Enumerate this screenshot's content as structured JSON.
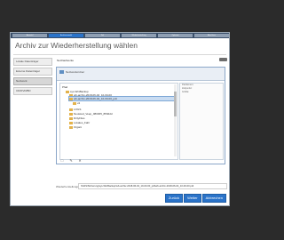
{
  "steps": [
    "Auswahl",
    "Archivauswahl",
    "Ziel",
    "Wiederherstellung",
    "Optionen",
    "Abschluss"
  ],
  "window": {
    "title": "Archiv zur Wiederherstellung wählen"
  },
  "sidebar": {
    "items": [
      {
        "label": "Lokale Datenträger"
      },
      {
        "label": "Externe Datenträger"
      },
      {
        "label": "Netzwerk"
      },
      {
        "label": "CD/DVD/BD"
      }
    ]
  },
  "filter": {
    "label": "Netzlaufwerke"
  },
  "browser": {
    "header": "Netzwerkordner",
    "path_root": "Pfad",
    "tree": [
      {
        "label": "sys-WinBackup",
        "indent": 0
      },
      {
        "label": "wb-archiv-2018-06-04_10-00-00",
        "indent": 1
      },
      {
        "label": "wb-archiv-2018-06-04_10-00-00_pdt",
        "indent": 1,
        "selected": true
      },
      {
        "label": "v2",
        "indent": 2
      },
      {
        "label": "LOGS",
        "indent": 1
      },
      {
        "label": "Neuwied_Veep_080305_8f6fddd",
        "indent": 1
      },
      {
        "label": "DirtyFiles",
        "indent": 1
      },
      {
        "label": "Lokales_Fahr",
        "indent": 1
      },
      {
        "label": "Organi",
        "indent": 1
      }
    ],
    "info": [
      "Partitionen:",
      "Zeitpunkt:",
      "Größe:"
    ]
  },
  "path": {
    "label": "Wiederherstellungspfad:",
    "value": "\\\\NAS\\Sicherung\\sys-WinBackup\\wb-archiv-2018-06-04_10-00-00_pdt\\wb-archiv-2018-06-04_10-00-00.pdt"
  },
  "buttons": {
    "back": "Zurück",
    "next": "Weiter",
    "cancel": "Abbrechen"
  }
}
